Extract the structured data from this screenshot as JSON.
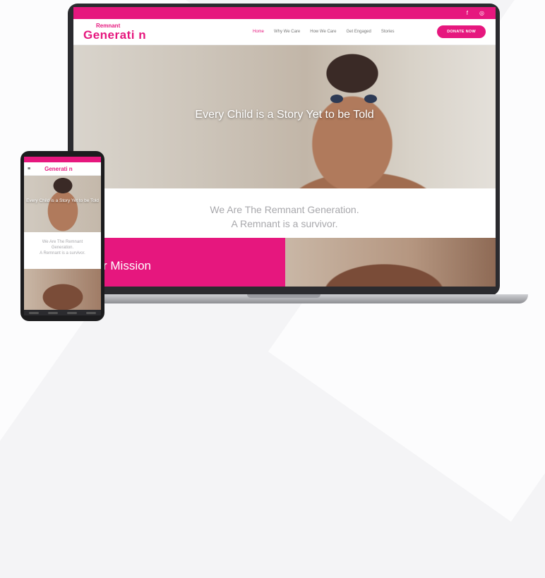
{
  "laptop_site": {
    "topbar": {
      "facebook_icon": "f",
      "instagram_icon": "◎"
    },
    "logo": {
      "line1": "Remnant",
      "line2": "Generati  n"
    },
    "menu": [
      "Home",
      "Why We Care",
      "How We Care",
      "Get Engaged",
      "Stories"
    ],
    "donate_label": "DONATE NOW",
    "hero_text": "Every Child is a Story Yet to be Told",
    "intro_line1": "We Are The Remnant Generation.",
    "intro_line2": "A Remnant is a survivor.",
    "mission_title": "r Mission"
  },
  "phone_site": {
    "logo": "Generati  n",
    "hero_text": "Every Child is a Story Yet to be Told",
    "intro_line1": "We Are The Remnant",
    "intro_line2": "Generation.",
    "intro_line3": "A Remnant is a survivor."
  },
  "colors": {
    "brand_pink": "#e6177e",
    "device_frame": "#2b2b2f"
  }
}
